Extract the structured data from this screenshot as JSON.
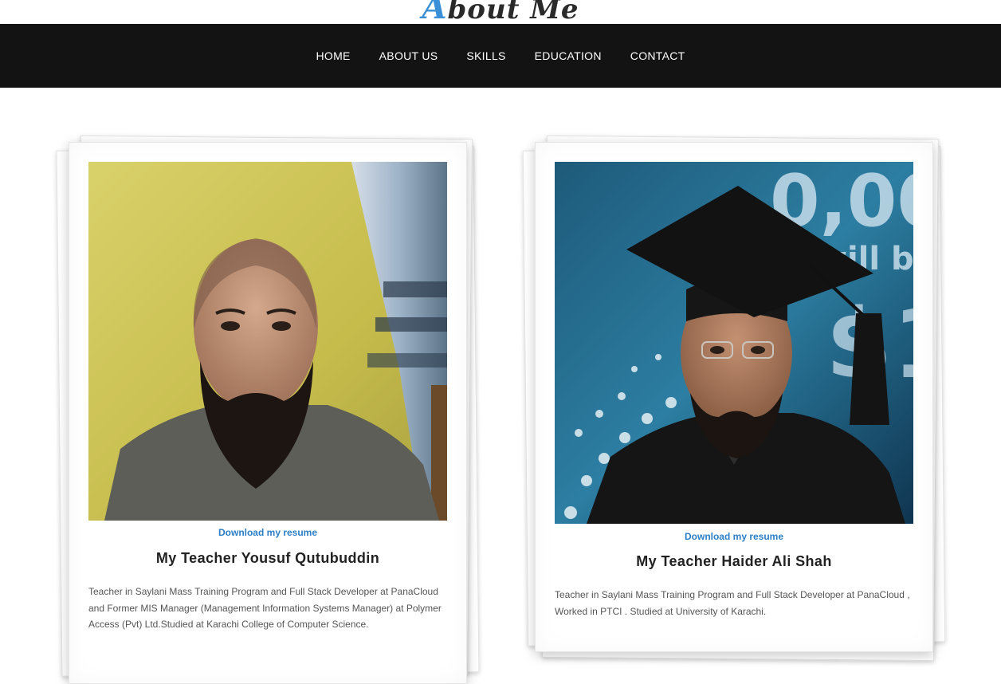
{
  "header": {
    "logo_first": "A",
    "logo_rest": "bout Me",
    "nav": [
      "HOME",
      "ABOUT US",
      "SKILLS",
      "EDUCATION",
      "CONTACT"
    ]
  },
  "profiles": [
    {
      "resume_label": "Download my resume",
      "title": "My Teacher Yousuf Qutubuddin",
      "description": "Teacher in Saylani Mass Training Program and Full Stack Developer at PanaCloud and Former MIS Manager (Management Information Systems Manager) at Polymer Access (Pvt) Ltd.Studied at Karachi College of Computer Science."
    },
    {
      "resume_label": "Download my resume",
      "title": "My Teacher Haider Ali Shah",
      "description": "Teacher in Saylani Mass Training Program and Full Stack Developer at PanaCloud , Worked in PTCI . Studied at University of Karachi."
    }
  ],
  "colors": {
    "nav_bg": "#131313",
    "link_blue": "#2d7fc6",
    "logo_accent": "#3a8fd6"
  }
}
